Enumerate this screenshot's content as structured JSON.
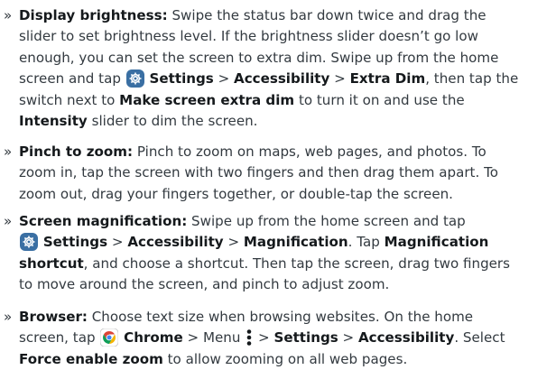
{
  "items": [
    {
      "lines": [
        [
          {
            "t": "Display brightness:",
            "b": true
          },
          {
            "t": " Swipe the status bar down twice and drag the"
          }
        ],
        [
          {
            "t": "slider to set brightness level. If the brightness slider doesn’t go low"
          }
        ],
        [
          {
            "t": "enough, you can set the screen to extra dim. Swipe up from the home"
          }
        ],
        [
          {
            "t": "screen and tap "
          },
          {
            "icon": "settings-gear-icon"
          },
          {
            "t": " "
          },
          {
            "t": "Settings",
            "b": true
          },
          {
            "t": " > "
          },
          {
            "t": "Accessibility",
            "b": true
          },
          {
            "t": " > "
          },
          {
            "t": "Extra Dim",
            "b": true
          },
          {
            "t": ", then tap the"
          }
        ],
        [
          {
            "t": "switch next to "
          },
          {
            "t": "Make screen extra dim",
            "b": true
          },
          {
            "t": " to turn it on and use the"
          }
        ],
        [
          {
            "t": "Intensity",
            "b": true
          },
          {
            "t": " slider to dim the screen."
          }
        ]
      ]
    },
    {
      "lines": [
        [
          {
            "t": "Pinch to zoom:",
            "b": true
          },
          {
            "t": " Pinch to zoom on maps, web pages, and photos. To"
          }
        ],
        [
          {
            "t": "zoom in, tap the screen with two fingers and then drag them apart. To"
          }
        ],
        [
          {
            "t": "zoom out, drag your fingers together, or double-tap the screen."
          }
        ]
      ]
    },
    {
      "lines": [
        [
          {
            "t": "Screen magnification:",
            "b": true
          },
          {
            "t": " Swipe up from the home screen and tap"
          }
        ],
        [
          {
            "icon": "settings-gear-icon"
          },
          {
            "t": " "
          },
          {
            "t": "Settings",
            "b": true
          },
          {
            "t": " > "
          },
          {
            "t": "Accessibility",
            "b": true
          },
          {
            "t": " > "
          },
          {
            "t": "Magnification",
            "b": true
          },
          {
            "t": ". Tap "
          },
          {
            "t": "Magnification",
            "b": true
          }
        ],
        [
          {
            "t": "shortcut",
            "b": true
          },
          {
            "t": ", and choose a shortcut. Then tap the screen, drag two fingers"
          }
        ],
        [
          {
            "t": "to move around the screen, and pinch to adjust zoom."
          }
        ]
      ]
    },
    {
      "lines": [
        [
          {
            "t": "Browser:",
            "b": true
          },
          {
            "t": " Choose text size when browsing websites. On the home"
          }
        ],
        [
          {
            "t": "screen, tap "
          },
          {
            "icon": "chrome-icon"
          },
          {
            "t": " "
          },
          {
            "t": "Chrome",
            "b": true
          },
          {
            "t": " > Menu "
          },
          {
            "icon": "menu-dots-icon"
          },
          {
            "t": " > "
          },
          {
            "t": "Settings",
            "b": true
          },
          {
            "t": " > "
          },
          {
            "t": "Accessibility",
            "b": true
          },
          {
            "t": ". Select"
          }
        ],
        [
          {
            "t": "Force enable zoom",
            "b": true
          },
          {
            "t": " to allow zooming on all web pages."
          }
        ]
      ]
    }
  ],
  "bullet_glyph": "»",
  "colors": {
    "text": "#333a40",
    "bold": "#15191c",
    "gear_bg": "#3a6fa3"
  }
}
